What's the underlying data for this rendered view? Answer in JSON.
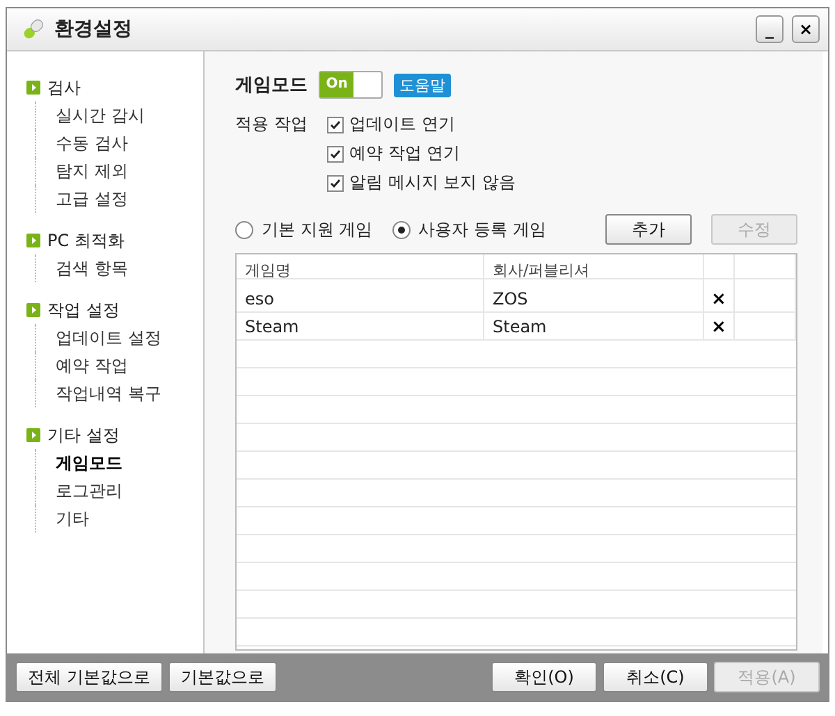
{
  "window": {
    "title": "환경설정",
    "buttons": [
      "_",
      "×"
    ]
  },
  "sidebar": {
    "groups": [
      {
        "label": "검사",
        "items": [
          {
            "label": "실시간 감시",
            "selected": false
          },
          {
            "label": "수동 검사",
            "selected": false
          },
          {
            "label": "탐지 제외",
            "selected": false
          },
          {
            "label": "고급 설정",
            "selected": false
          }
        ]
      },
      {
        "label": "PC 최적화",
        "items": [
          {
            "label": "검색 항목",
            "selected": false
          }
        ]
      },
      {
        "label": "작업 설정",
        "items": [
          {
            "label": "업데이트 설정",
            "selected": false
          },
          {
            "label": "예약 작업",
            "selected": false
          },
          {
            "label": "작업내역 복구",
            "selected": false
          }
        ]
      },
      {
        "label": "기타 설정",
        "items": [
          {
            "label": "게임모드",
            "selected": true
          },
          {
            "label": "로그관리",
            "selected": false
          },
          {
            "label": "기타",
            "selected": false
          }
        ]
      }
    ]
  },
  "game_mode": {
    "title": "게임모드",
    "toggle": {
      "label": "On",
      "on": true
    },
    "help": "도움말"
  },
  "apply_tasks": {
    "label": "적용 작업",
    "options": [
      {
        "label": "업데이트 연기",
        "checked": true
      },
      {
        "label": "예약 작업 연기",
        "checked": true
      },
      {
        "label": "알림 메시지 보지 않음",
        "checked": true
      }
    ]
  },
  "game_source": [
    {
      "label": "기본 지원 게임",
      "selected": false
    },
    {
      "label": "사용자 등록 게임",
      "selected": true
    }
  ],
  "list_buttons": [
    {
      "label": "추가",
      "disabled": false
    },
    {
      "label": "수정",
      "disabled": true
    }
  ],
  "table": {
    "columns": [
      "게임명",
      "회사/퍼블리셔"
    ],
    "rows": [
      {
        "name": "eso",
        "publisher": "ZOS",
        "delete": "×"
      },
      {
        "name": "Steam",
        "publisher": "Steam",
        "delete": "×"
      }
    ]
  },
  "footer": {
    "left": [
      {
        "label": "전체 기본값으로",
        "disabled": false
      },
      {
        "label": "기본값으로",
        "disabled": false
      }
    ],
    "right": [
      {
        "label": "확인(O)",
        "disabled": false
      },
      {
        "label": "취소(C)",
        "disabled": false
      },
      {
        "label": "적용(A)",
        "disabled": true
      }
    ]
  }
}
